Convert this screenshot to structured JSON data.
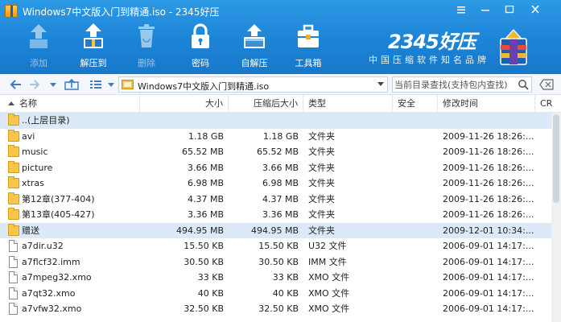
{
  "window": {
    "title": "Windows7中文版入门到精通.iso - 2345好压",
    "controls": [
      "menu",
      "minimize",
      "maximize",
      "close"
    ]
  },
  "toolbar": {
    "items": [
      {
        "label": "添加",
        "icon": "add-archive-icon",
        "enabled": false
      },
      {
        "label": "解压到",
        "icon": "extract-to-icon",
        "enabled": true
      },
      {
        "label": "删除",
        "icon": "delete-icon",
        "enabled": false
      },
      {
        "label": "密码",
        "icon": "password-lock-icon",
        "enabled": true
      },
      {
        "label": "自解压",
        "icon": "self-extract-icon",
        "enabled": true
      },
      {
        "label": "工具箱",
        "icon": "toolbox-icon",
        "enabled": true
      }
    ]
  },
  "brand": {
    "name": "2345好压",
    "slogan": "中国压缩软件知名品牌"
  },
  "addressbar": {
    "path": "Windows7中文版入门到精通.iso",
    "search_placeholder": "当前目录查找(支持包内查找)"
  },
  "columns": [
    "名称",
    "大小",
    "压缩后大小",
    "类型",
    "安全",
    "修改时间",
    "CR"
  ],
  "files": [
    {
      "name": "..(上层目录)",
      "size": "",
      "packed": "",
      "type": "",
      "security": "",
      "modified": "",
      "kind": "folder",
      "selected": true
    },
    {
      "name": "avi",
      "size": "1.18 GB",
      "packed": "1.18 GB",
      "type": "文件夹",
      "security": "",
      "modified": "2009-11-26 18:26:...",
      "kind": "folder",
      "selected": false
    },
    {
      "name": "music",
      "size": "65.52 MB",
      "packed": "65.52 MB",
      "type": "文件夹",
      "security": "",
      "modified": "2009-11-26 18:26:...",
      "kind": "folder",
      "selected": false
    },
    {
      "name": "picture",
      "size": "3.66 MB",
      "packed": "3.66 MB",
      "type": "文件夹",
      "security": "",
      "modified": "2009-11-26 18:26:...",
      "kind": "folder",
      "selected": false
    },
    {
      "name": "xtras",
      "size": "6.98 MB",
      "packed": "6.98 MB",
      "type": "文件夹",
      "security": "",
      "modified": "2009-11-26 18:26:...",
      "kind": "folder",
      "selected": false
    },
    {
      "name": "第12章(377-404)",
      "size": "4.37 MB",
      "packed": "4.37 MB",
      "type": "文件夹",
      "security": "",
      "modified": "2009-11-26 18:26:...",
      "kind": "folder",
      "selected": false
    },
    {
      "name": "第13章(405-427)",
      "size": "3.36 MB",
      "packed": "3.36 MB",
      "type": "文件夹",
      "security": "",
      "modified": "2009-11-26 18:26:...",
      "kind": "folder",
      "selected": false
    },
    {
      "name": "赠送",
      "size": "494.95 MB",
      "packed": "494.95 MB",
      "type": "文件夹",
      "security": "",
      "modified": "2009-12-01 10:34:...",
      "kind": "folder",
      "selected": true
    },
    {
      "name": "a7dir.u32",
      "size": "15.50 KB",
      "packed": "15.50 KB",
      "type": "U32 文件",
      "security": "",
      "modified": "2006-09-01 14:17:...",
      "kind": "file",
      "selected": false
    },
    {
      "name": "a7flcf32.imm",
      "size": "30.50 KB",
      "packed": "30.50 KB",
      "type": "IMM 文件",
      "security": "",
      "modified": "2006-09-01 14:17:...",
      "kind": "file",
      "selected": false
    },
    {
      "name": "a7mpeg32.xmo",
      "size": "33 KB",
      "packed": "33 KB",
      "type": "XMO 文件",
      "security": "",
      "modified": "2006-09-01 14:17:...",
      "kind": "file",
      "selected": false
    },
    {
      "name": "a7qt32.xmo",
      "size": "40 KB",
      "packed": "40 KB",
      "type": "XMO 文件",
      "security": "",
      "modified": "2006-09-01 14:17:...",
      "kind": "file",
      "selected": false
    },
    {
      "name": "a7vfw32.xmo",
      "size": "32.50 KB",
      "packed": "32.50 KB",
      "type": "XMO 文件",
      "security": "",
      "modified": "2006-09-01 14:17:...",
      "kind": "file",
      "selected": false
    }
  ],
  "colors": {
    "header_blue": "#1c84d6",
    "selection": "#dbe9f8",
    "folder": "#f6c748"
  }
}
